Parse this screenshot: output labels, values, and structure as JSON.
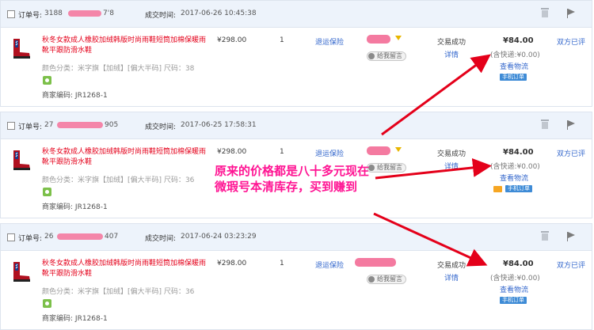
{
  "labels": {
    "order_no": "订单号:",
    "deal_time": "成交时间:",
    "attr_label": "颜色分类：",
    "code_label": "商家编码:",
    "return_insurance": "退运保险",
    "leave_message": "给我留言",
    "status": "交易成功",
    "detail": "详情",
    "logistics": "查看物流",
    "phone_order": "手机订单",
    "review": "双方已评"
  },
  "orders": [
    {
      "no_prefix": "3188",
      "no_suffix": "7'8",
      "time": "2017-06-26 10:45:38",
      "title": "秋冬女款成人橡胶加绒韩版时尚雨鞋短筒加棉保暖雨靴平跟防滑水鞋",
      "attr": "米字旗【加绒】[偏大半码]",
      "size_label": "尺码：",
      "size": "38",
      "code": "JR1268-1",
      "price": "¥298.00",
      "qty": "1",
      "total": "¥84.00",
      "shipping": "(含快递:¥0.00)"
    },
    {
      "no_prefix": "27",
      "no_suffix": "905",
      "time": "2017-06-25 17:58:31",
      "title": "秋冬女款成人橡胶加绒韩版时尚雨鞋短筒加棉保暖雨靴平跟防滑水鞋",
      "attr": "米字旗【加绒】[偏大半码]",
      "size_label": "尺码：",
      "size": "36",
      "code": "JR1268-1",
      "price": "¥298.00",
      "qty": "1",
      "total": "¥84.00",
      "shipping": "(含快递:¥0.00)"
    },
    {
      "no_prefix": "26",
      "no_suffix": "407",
      "time": "2017-06-24 03:23:29",
      "title": "秋冬女款成人橡胶加绒韩版时尚雨鞋短筒加棉保暖雨靴平跟防滑水鞋",
      "attr": "米字旗【加绒】[偏大半码]",
      "size_label": "尺码：",
      "size": "36",
      "code": "JR1268-1",
      "price": "¥298.00",
      "qty": "1",
      "total": "¥84.00",
      "shipping": "(含快递:¥0.00)"
    }
  ],
  "annotation": "原来的价格都是八十多元现在微瑕号本清库存，买到赚到",
  "colors": {
    "header_bg": "#edf3fb",
    "title_red": "#e4001a",
    "link_blue": "#3266cc",
    "annotation_pink": "#ff1493",
    "arrow_red": "#e4001a"
  }
}
